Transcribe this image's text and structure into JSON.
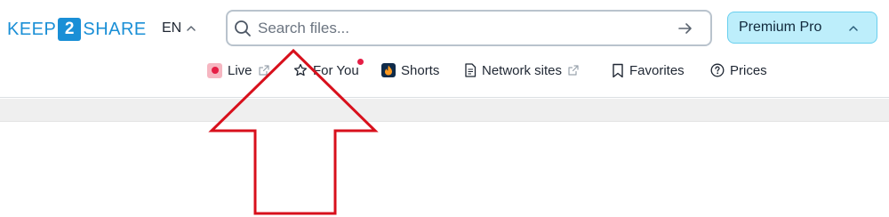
{
  "header": {
    "logo": {
      "left": "KEEP",
      "number": "2",
      "right": "SHARE"
    },
    "language": {
      "label": "EN",
      "icon": "chevron-up-icon"
    },
    "search": {
      "placeholder": "Search files...",
      "value": "",
      "icon": "search-icon",
      "submit_icon": "arrow-right-icon"
    },
    "premium": {
      "label": "Premium Pro",
      "icon": "chevron-up-icon"
    }
  },
  "nav": {
    "items": [
      {
        "label": "Live",
        "icon": "live-dot-icon",
        "external": true
      },
      {
        "label": "For You",
        "icon": "star-icon",
        "notification": true
      },
      {
        "label": "Shorts",
        "icon": "flame-icon"
      },
      {
        "label": "Network sites",
        "icon": "document-icon",
        "external": true
      },
      {
        "label": "Favorites",
        "icon": "bookmark-icon"
      },
      {
        "label": "Prices",
        "icon": "question-circle-icon"
      }
    ]
  },
  "colors": {
    "brand": "#1a8fd6",
    "premium_bg": "#bdeefb",
    "premium_border": "#69cfee",
    "live_red": "#e51e45",
    "annotation_arrow": "#d8101c"
  },
  "annotation": {
    "type": "arrow-up",
    "color": "#d8101c"
  }
}
